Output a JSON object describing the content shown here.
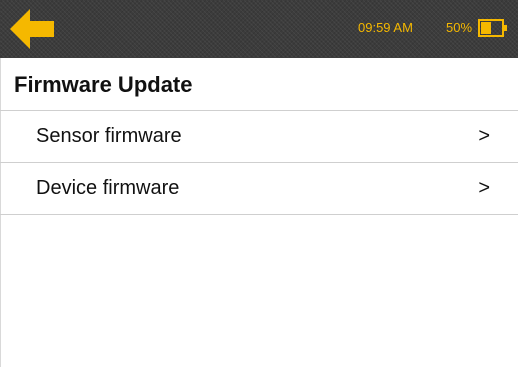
{
  "status_bar": {
    "time": "09:59 AM",
    "battery_percent": "50%",
    "battery_level": 0.5,
    "accent_color": "#f5b800",
    "background_color": "#3c3c3c",
    "back_icon": "back-arrow-icon",
    "battery_icon": "battery-icon"
  },
  "page": {
    "title": "Firmware Update"
  },
  "menu": {
    "items": [
      {
        "label": "Sensor firmware",
        "chevron": ">"
      },
      {
        "label": "Device firmware",
        "chevron": ">"
      }
    ]
  }
}
